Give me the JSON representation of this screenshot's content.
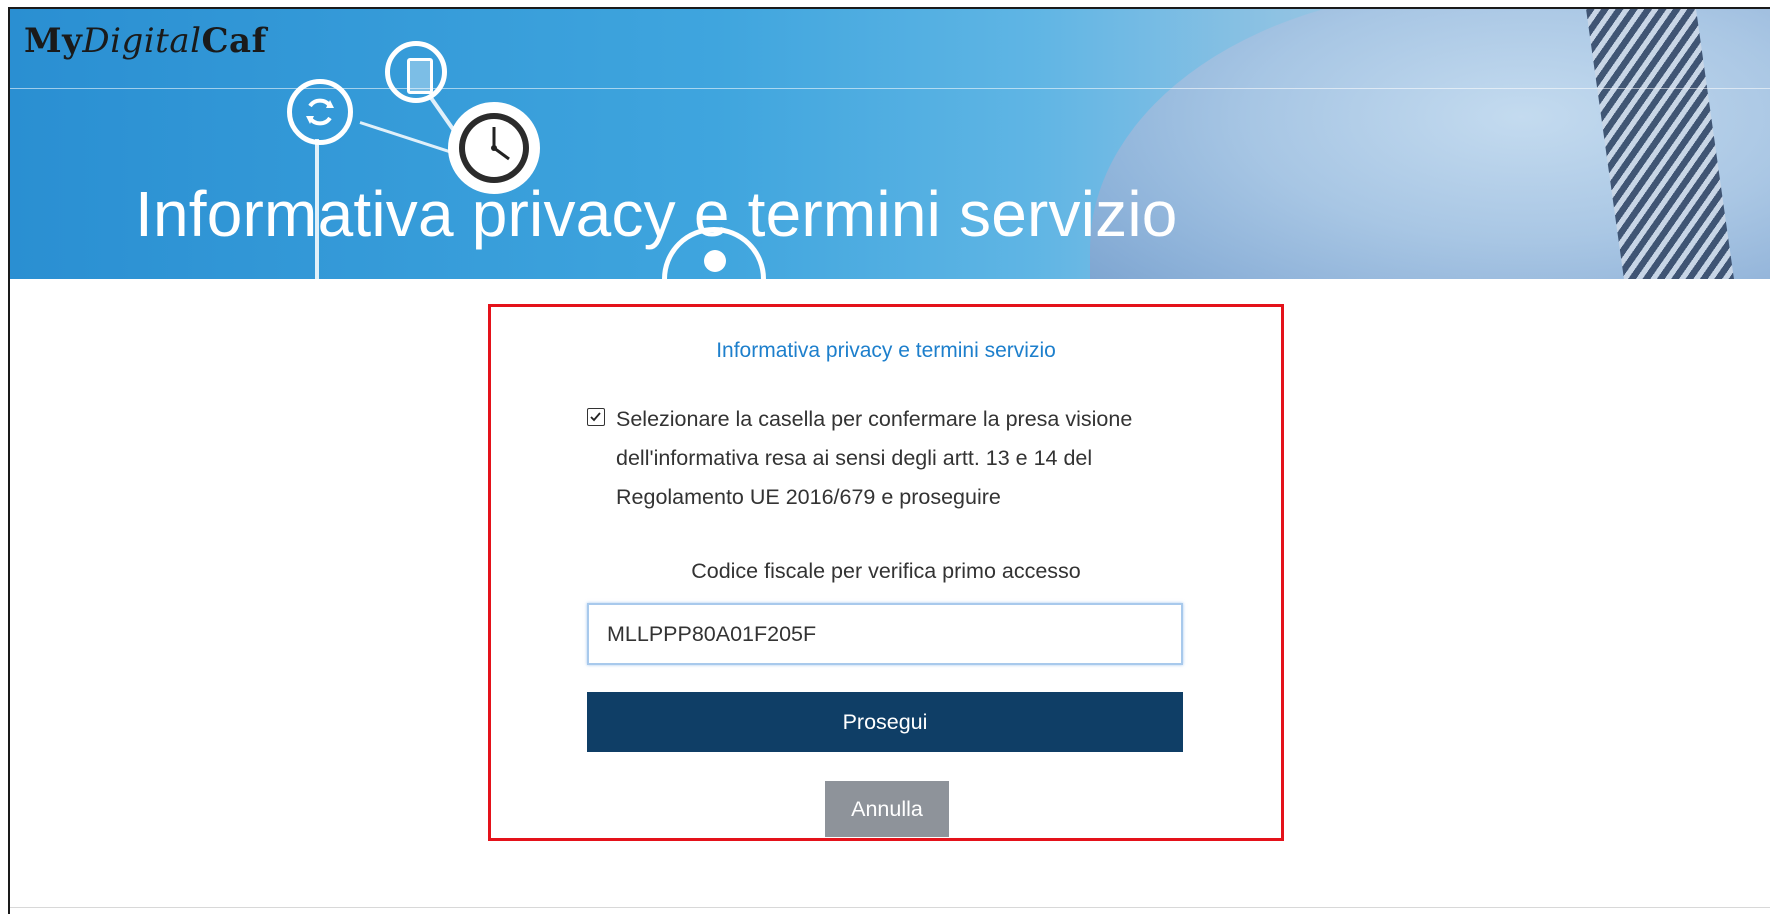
{
  "header": {
    "logo": {
      "part1": "My",
      "part2": "Digital",
      "part3": "Caf"
    },
    "title": "Informativa privacy e termini servizio"
  },
  "card": {
    "title": "Informativa privacy e termini servizio",
    "consent": {
      "checked": true,
      "text": "Selezionare la casella per confermare la presa visione dell'informativa resa ai sensi degli artt. 13 e 14 del Regolamento UE 2016/679 e proseguire"
    },
    "codice_fiscale": {
      "label": "Codice fiscale per verifica primo accesso",
      "value": "MLLPPP80A01F205F"
    },
    "proceed_label": "Prosegui",
    "cancel_label": "Annulla"
  },
  "colors": {
    "accent": "#1d7fcc",
    "primary_button": "#0f3e66",
    "secondary_button": "#8e939a",
    "highlight_border": "#e4121a"
  }
}
